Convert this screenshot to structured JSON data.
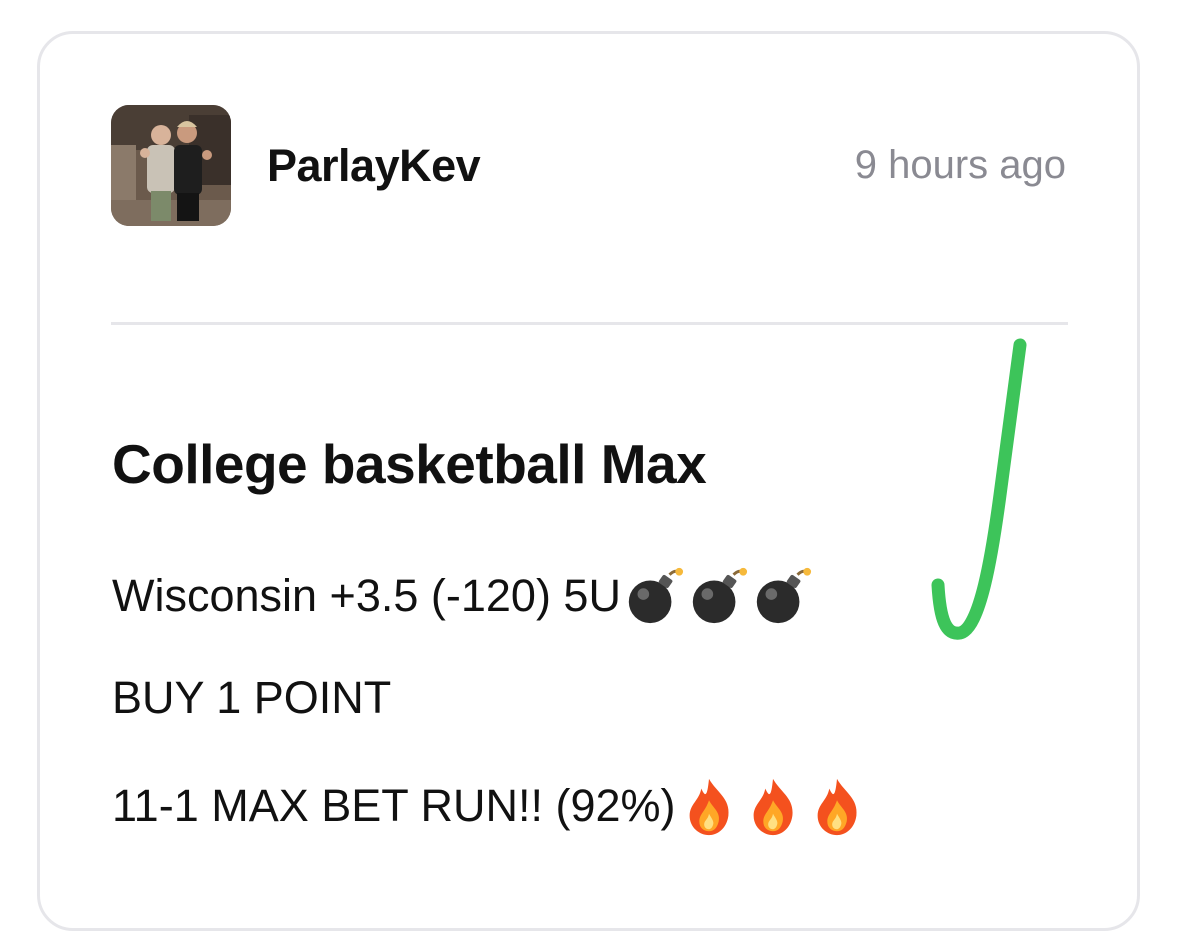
{
  "post": {
    "username": "ParlayKev",
    "timestamp": "9 hours ago",
    "title": "College basketball Max",
    "lines": {
      "pick_text": "Wisconsin +3.5 (-120) 5U",
      "pick_emojis": [
        "bomb-icon",
        "bomb-icon",
        "bomb-icon"
      ],
      "buy_text": "BUY 1 POINT",
      "record_text": "11-1 MAX BET RUN!! (92%)",
      "record_emojis": [
        "fire-icon",
        "fire-icon",
        "fire-icon"
      ]
    }
  },
  "colors": {
    "check_mark": "#3dc45a",
    "divider": "#e6e6ea",
    "timestamp": "#8a8a92"
  }
}
